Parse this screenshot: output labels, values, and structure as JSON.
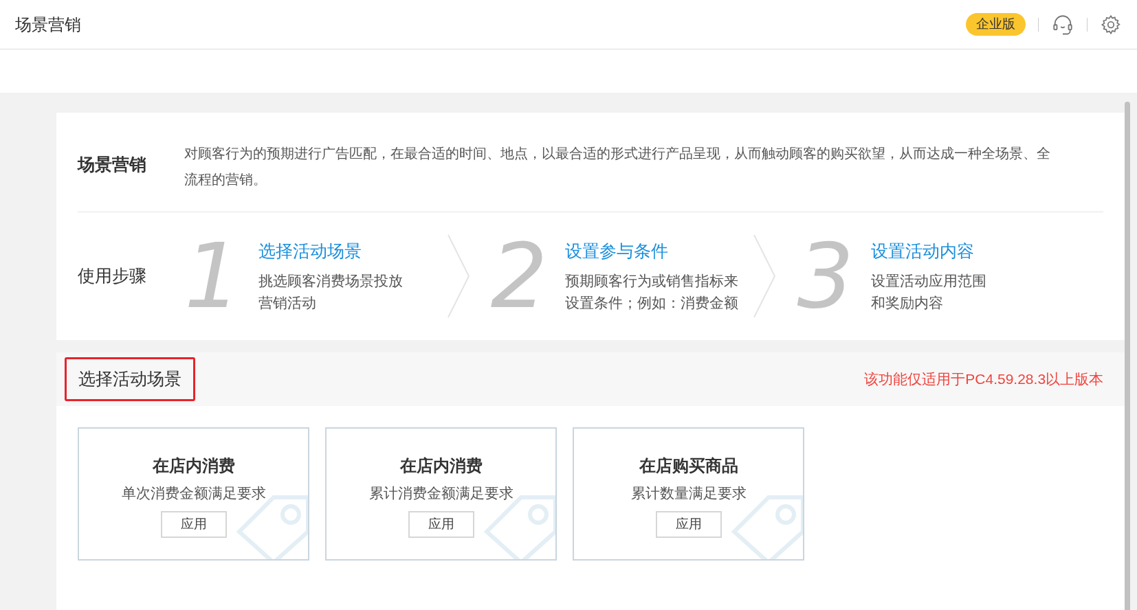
{
  "header": {
    "title": "场景营销",
    "badge": "企业版"
  },
  "intro": {
    "label": "场景营销",
    "description": "对顾客行为的预期进行广告匹配，在最合适的时间、地点，以最合适的形式进行产品呈现，从而触动顾客的购买欲望，从而达成一种全场景、全流程的营销。"
  },
  "steps": {
    "label": "使用步骤",
    "items": [
      {
        "number": "1",
        "title": "选择活动场景",
        "lines": [
          "挑选顾客消费场景投放",
          "营销活动"
        ]
      },
      {
        "number": "2",
        "title": "设置参与条件",
        "lines": [
          "预期顾客行为或销售指标来",
          "设置条件；例如：消费金额"
        ]
      },
      {
        "number": "3",
        "title": "设置活动内容",
        "lines": [
          "设置活动应用范围",
          "和奖励内容"
        ]
      }
    ]
  },
  "section": {
    "title": "选择活动场景",
    "notice": "该功能仅适用于PC4.59.28.3以上版本"
  },
  "scenes": [
    {
      "title": "在店内消费",
      "subtitle": "单次消费金额满足要求",
      "button": "应用"
    },
    {
      "title": "在店内消费",
      "subtitle": "累计消费金额满足要求",
      "button": "应用"
    },
    {
      "title": "在店购买商品",
      "subtitle": "累计数量满足要求",
      "button": "应用"
    }
  ]
}
